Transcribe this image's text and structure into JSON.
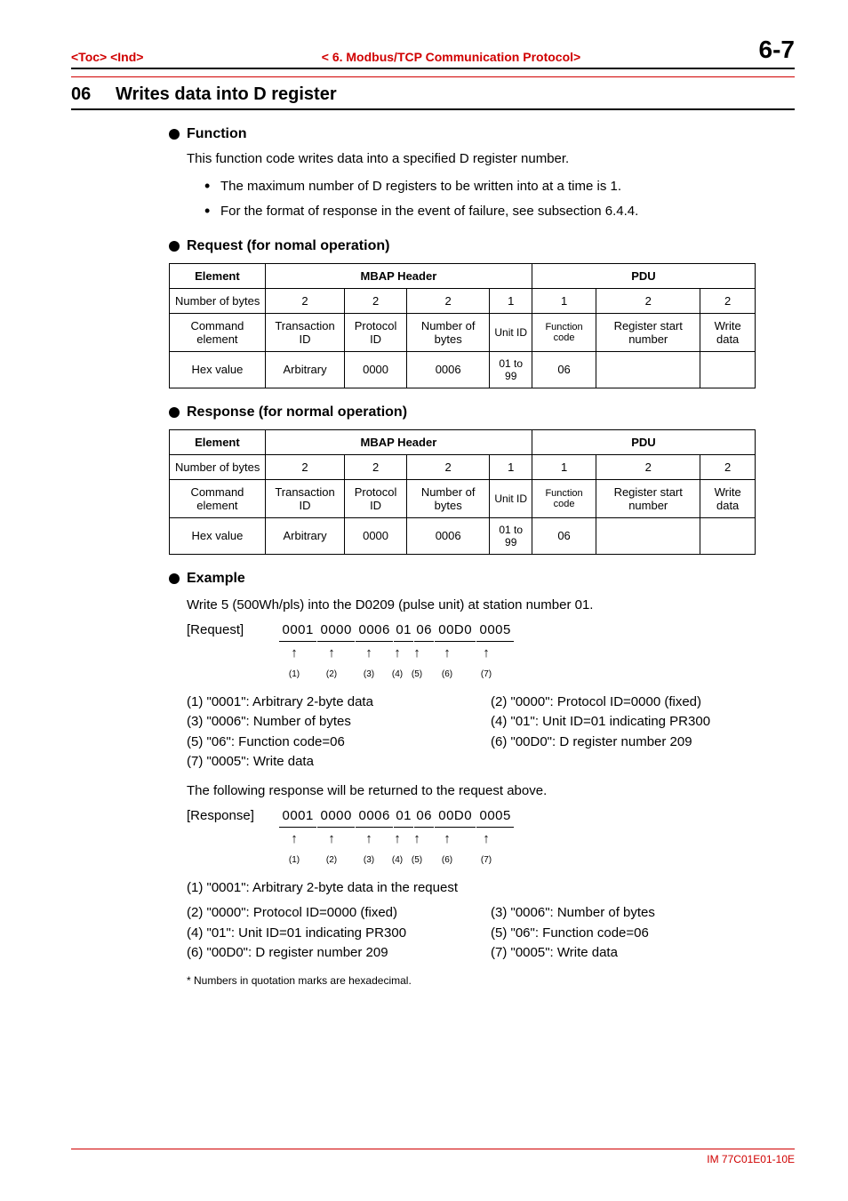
{
  "header": {
    "left": "<Toc> <Ind>",
    "center": "< 6.   Modbus/TCP Communication Protocol>",
    "page": "6-7"
  },
  "section": {
    "number": "06",
    "title": "Writes data into D register"
  },
  "function": {
    "heading": "Function",
    "desc": "This function code writes data into a specified D register number.",
    "bullets": [
      "The maximum number of D registers to be written into at a time is 1.",
      "For the format of response in the event of failure, see subsection 6.4.4."
    ]
  },
  "request": {
    "heading": "Request (for nomal operation)",
    "table": {
      "col_element": "Element",
      "col_mbap": "MBAP Header",
      "col_pdu": "PDU",
      "row_numbytes_label": "Number of bytes",
      "row_numbytes": [
        "2",
        "2",
        "2",
        "1",
        "1",
        "2",
        "2"
      ],
      "row_cmd_label": "Command element",
      "row_cmd": [
        "Transaction ID",
        "Protocol ID",
        "Number of bytes",
        "Unit ID",
        "Function code",
        "Register start number",
        "Write data"
      ],
      "row_hex_label": "Hex value",
      "row_hex": [
        "Arbitrary",
        "0000",
        "0006",
        "01 to 99",
        "06",
        "",
        ""
      ]
    }
  },
  "response": {
    "heading": "Response (for normal operation)",
    "table": {
      "col_element": "Element",
      "col_mbap": "MBAP Header",
      "col_pdu": "PDU",
      "row_numbytes_label": "Number of bytes",
      "row_numbytes": [
        "2",
        "2",
        "2",
        "1",
        "1",
        "2",
        "2"
      ],
      "row_cmd_label": "Command element",
      "row_cmd": [
        "Transaction ID",
        "Protocol ID",
        "Number of bytes",
        "Unit ID",
        "Function code",
        "Register start number",
        "Write data"
      ],
      "row_hex_label": "Hex value",
      "row_hex": [
        "Arbitrary",
        "0000",
        "0006",
        "01 to 99",
        "06",
        "",
        ""
      ]
    }
  },
  "example": {
    "heading": "Example",
    "intro": "Write 5 (500Wh/pls) into the D0209 (pulse unit) at station number 01.",
    "request_label": "[Request]",
    "request_hex_segments": [
      "0001",
      "0000",
      "0006",
      "01",
      "06",
      "00D0",
      "0005"
    ],
    "request_indices": [
      "(1)",
      "(2)",
      "(3)",
      "(4)",
      "(5)",
      "(6)",
      "(7)"
    ],
    "request_notes_left": [
      "(1) \"0001\": Arbitrary 2-byte data",
      "(3) \"0006\": Number of bytes",
      "(5) \"06\": Function code=06",
      "(7) \"0005\": Write data"
    ],
    "request_notes_right": [
      "(2) \"0000\": Protocol ID=0000 (fixed)",
      "(4) \"01\": Unit ID=01 indicating PR300",
      "(6) \"00D0\": D register number 209"
    ],
    "response_intro": "The following response will be returned to the request above.",
    "response_label": "[Response]",
    "response_hex_segments": [
      "0001",
      "0000",
      "0006",
      "01",
      "06",
      "00D0",
      "0005"
    ],
    "response_indices": [
      "(1)",
      "(2)",
      "(3)",
      "(4)",
      "(5)",
      "(6)",
      "(7)"
    ],
    "response_note_top": "(1) \"0001\": Arbitrary 2-byte data in the request",
    "response_notes_left": [
      "(2) \"0000\": Protocol ID=0000 (fixed)",
      "(4) \"01\": Unit ID=01 indicating PR300",
      "(6) \"00D0\": D register number 209"
    ],
    "response_notes_right": [
      "(3) \"0006\": Number of bytes",
      "(5) \"06\": Function code=06",
      "(7) \"0005\": Write data"
    ],
    "footnote": "* Numbers in quotation marks are hexadecimal."
  },
  "footer": "IM 77C01E01-10E"
}
